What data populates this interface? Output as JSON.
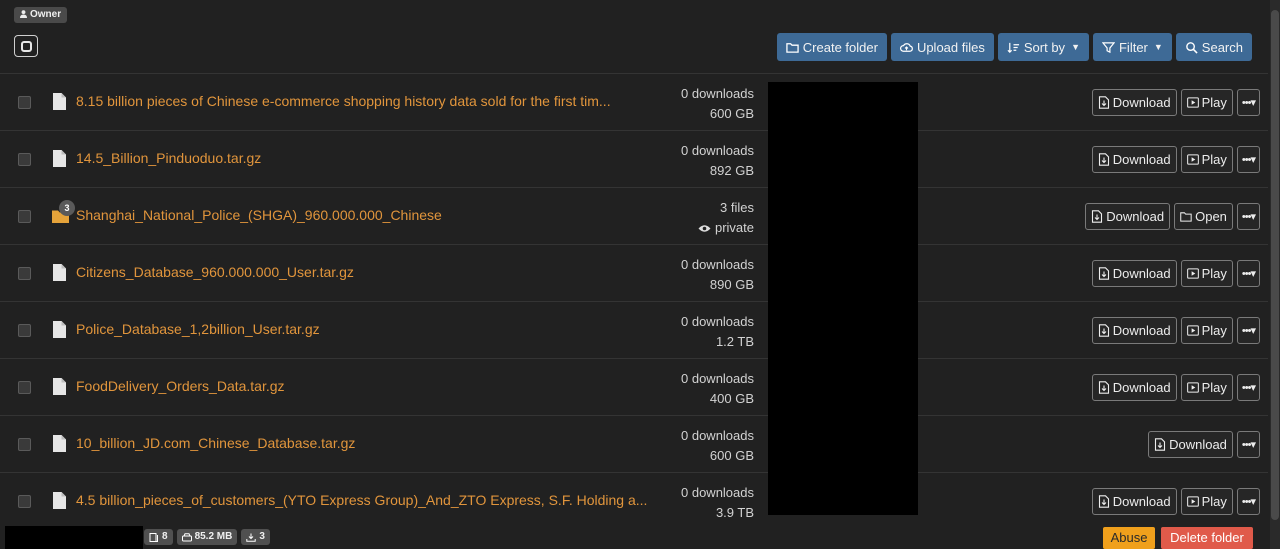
{
  "owner_badge": "Owner",
  "toolbar": {
    "create_folder": "Create folder",
    "upload_files": "Upload files",
    "sort_by": "Sort by",
    "filter": "Filter",
    "search": "Search"
  },
  "rows": [
    {
      "type": "file",
      "name": "8.15 billion pieces of Chinese e-commerce shopping history data sold for the first tim...",
      "meta1": "0 downloads",
      "meta2": "600 GB",
      "actions": [
        "Download",
        "Play"
      ]
    },
    {
      "type": "file",
      "name": "14.5_Billion_Pinduoduo.tar.gz",
      "meta1": "0 downloads",
      "meta2": "892 GB",
      "actions": [
        "Download",
        "Play"
      ]
    },
    {
      "type": "folder",
      "badge": "3",
      "name": "Shanghai_National_Police_(SHGA)_960.000.000_Chinese",
      "meta1": "3 files",
      "meta2": "private",
      "actions": [
        "Download",
        "Open"
      ]
    },
    {
      "type": "file",
      "name": "Citizens_Database_960.000.000_User.tar.gz",
      "meta1": "0 downloads",
      "meta2": "890 GB",
      "actions": [
        "Download",
        "Play"
      ]
    },
    {
      "type": "file",
      "name": "Police_Database_1,2billion_User.tar.gz",
      "meta1": "0 downloads",
      "meta2": "1.2 TB",
      "actions": [
        "Download",
        "Play"
      ]
    },
    {
      "type": "file",
      "name": "FoodDelivery_Orders_Data.tar.gz",
      "meta1": "0 downloads",
      "meta2": "400 GB",
      "actions": [
        "Download",
        "Play"
      ]
    },
    {
      "type": "file",
      "name": "10_billion_JD.com_Chinese_Database.tar.gz",
      "meta1": "0 downloads",
      "meta2": "600 GB",
      "actions": [
        "Download"
      ]
    },
    {
      "type": "file",
      "name": "4.5 billion_pieces_of_customers_(YTO Express Group)_And_ZTO Express, S.F. Holding a...",
      "meta1": "0 downloads",
      "meta2": "3.9 TB",
      "actions": [
        "Download",
        "Play"
      ]
    }
  ],
  "footer": {
    "files": "8",
    "size": "85.2 MB",
    "downloads": "3",
    "abuse": "Abuse",
    "delete_folder": "Delete folder"
  },
  "colors": {
    "accent": "#3e6a96",
    "filename": "#e1953c",
    "abuse": "#f0a01c",
    "delete": "#e05a4a"
  }
}
